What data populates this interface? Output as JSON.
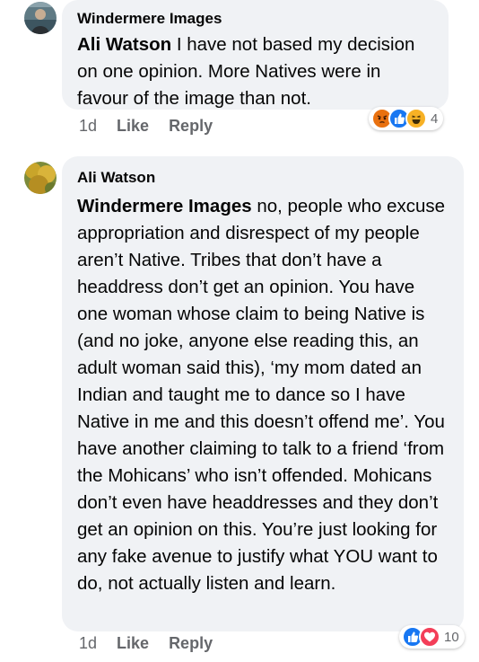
{
  "comments": [
    {
      "author": "Windermere Images",
      "mention": "Ali Watson",
      "text": " I have not based my decision on one opinion. More Natives were in favour of the image than not.",
      "time": "1d",
      "like_label": "Like",
      "reply_label": "Reply",
      "reaction_icons": [
        "angry-icon",
        "like-icon",
        "haha-icon"
      ],
      "reaction_count": "4"
    },
    {
      "author": "Ali Watson",
      "mention": "Windermere Images",
      "text": " no, people who excuse appropriation and disrespect of my people aren’t Native. Tribes that don’t have a headdress don’t get an opinion. You have one woman whose claim to being Native is (and no joke, anyone else reading this, an adult woman said this), ‘my mom dated an Indian and taught me to dance so I have Native in me and this doesn’t offend me’. You have another claiming to talk to a friend ‘from the Mohicans’ who isn’t offended. Mohicans don’t even have headdresses and they don’t get an opinion on this. You’re just looking for any fake avenue to justify what YOU want to do, not actually listen and learn.",
      "time": "1d",
      "like_label": "Like",
      "reply_label": "Reply",
      "reaction_icons": [
        "like-icon",
        "love-icon"
      ],
      "reaction_count": "10"
    }
  ],
  "colors": {
    "bubble": "#f0f2f5",
    "meta_text": "#65676b",
    "like_blue": "#1877f2",
    "love_red": "#f33e58",
    "angry_orange": "#e9710f",
    "haha_yellow": "#f7b125"
  }
}
